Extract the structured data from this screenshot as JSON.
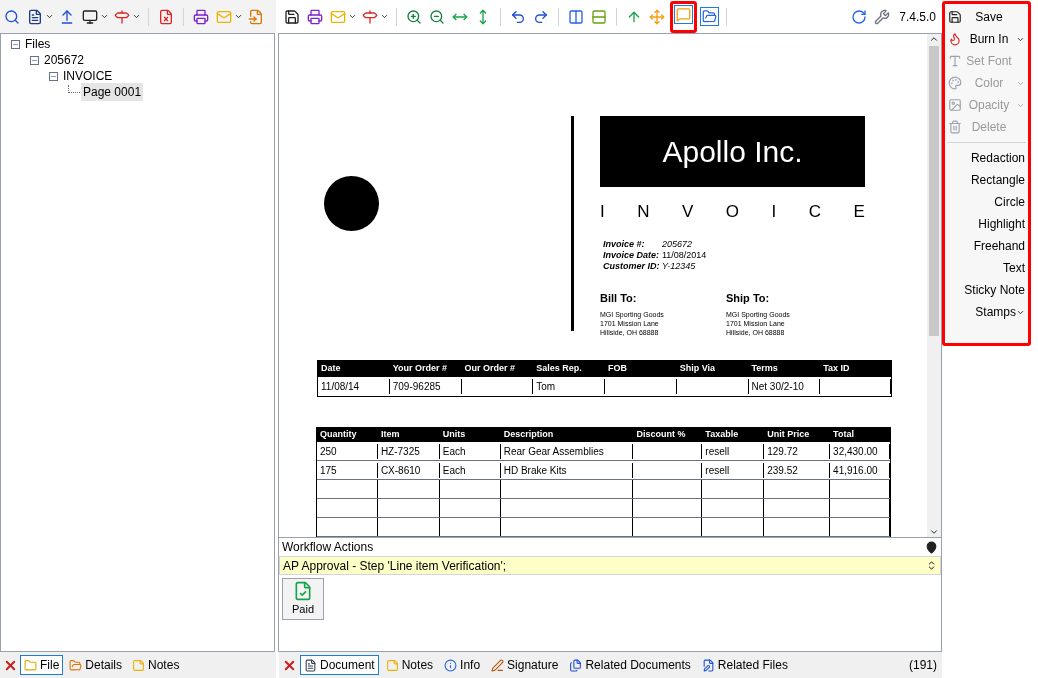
{
  "tree": {
    "label": "Files",
    "expanded": true,
    "selected": false,
    "children": [
      {
        "label": "205672",
        "expanded": true,
        "selected": false,
        "children": [
          {
            "label": "INVOICE",
            "expanded": true,
            "selected": false,
            "children": [
              {
                "label": "Page 0001",
                "selected": true
              }
            ]
          }
        ]
      }
    ]
  },
  "version": "7.4.5.0",
  "annotation_menu": [
    {
      "label": "Save",
      "kind": "button",
      "disabled": false
    },
    {
      "label": "Burn In",
      "kind": "dropdown",
      "disabled": false
    },
    {
      "label": "Set Font",
      "kind": "button",
      "disabled": true
    },
    {
      "label": "Color",
      "kind": "dropdown",
      "disabled": true
    },
    {
      "label": "Opacity",
      "kind": "dropdown",
      "disabled": true
    },
    {
      "label": "Delete",
      "kind": "button",
      "disabled": true
    },
    {
      "kind": "separator"
    },
    {
      "label": "Redaction",
      "kind": "button",
      "disabled": false
    },
    {
      "label": "Rectangle",
      "kind": "button",
      "disabled": false
    },
    {
      "label": "Circle",
      "kind": "button",
      "disabled": false
    },
    {
      "label": "Highlight",
      "kind": "button",
      "disabled": false
    },
    {
      "label": "Freehand",
      "kind": "button",
      "disabled": false
    },
    {
      "label": "Text",
      "kind": "button",
      "disabled": false
    },
    {
      "label": "Sticky Note",
      "kind": "button",
      "disabled": false
    },
    {
      "label": "Stamps",
      "kind": "dropdown",
      "disabled": false
    }
  ],
  "document": {
    "company": "Apollo Inc.",
    "title_letters": [
      "I",
      "N",
      "V",
      "O",
      "I",
      "C",
      "E"
    ],
    "meta": [
      {
        "label": "Invoice #:",
        "value": "205672"
      },
      {
        "label": "Invoice Date:",
        "value": "11/08/2014"
      },
      {
        "label": "Customer ID:",
        "value": "Y-12345"
      }
    ],
    "addresses": [
      {
        "heading": "Bill To:",
        "lines": [
          "MGI Sporting Goods",
          "1701 Mission Lane",
          "Hillside, OH 68888"
        ]
      },
      {
        "heading": "Ship To:",
        "lines": [
          "MGI Sporting Goods",
          "1701 Mission Lane",
          "Hillside, OH 68888"
        ]
      }
    ],
    "order_table": {
      "columns": [
        "Date",
        "Your Order #",
        "Our Order #",
        "Sales Rep.",
        "FOB",
        "Ship Via",
        "Terms",
        "Tax ID"
      ],
      "rows": [
        [
          "11/08/14",
          "709-96285",
          null,
          "Tom",
          null,
          null,
          "Net 30/2-10",
          null
        ]
      ]
    },
    "items_table": {
      "columns": [
        "Quantity",
        "Item",
        "Units",
        "Description",
        "Discount %",
        "Taxable",
        "Unit Price",
        "Total"
      ],
      "rows": [
        [
          "250",
          "HZ-7325",
          "Each",
          "Rear Gear Assemblies",
          null,
          "resell",
          "129.72",
          "32,430.00"
        ],
        [
          "175",
          "CX-8610",
          "Each",
          "HD Brake Kits",
          null,
          "resell",
          "239.52",
          "41,916.00"
        ]
      ]
    }
  },
  "workflow": {
    "title": "Workflow Actions",
    "step": "AP Approval - Step 'Line item Verification';",
    "actions": [
      {
        "label": "Paid"
      }
    ]
  },
  "left_tabs": [
    {
      "label": "File",
      "selected": true
    },
    {
      "label": "Details",
      "selected": false
    },
    {
      "label": "Notes",
      "selected": false
    }
  ],
  "doc_tabs": [
    {
      "label": "Document",
      "selected": true
    },
    {
      "label": "Notes",
      "selected": false
    },
    {
      "label": "Info",
      "selected": false
    },
    {
      "label": "Signature",
      "selected": false
    },
    {
      "label": "Related Documents",
      "selected": false
    },
    {
      "label": "Related Files",
      "selected": false
    }
  ],
  "page_count": "(191)"
}
